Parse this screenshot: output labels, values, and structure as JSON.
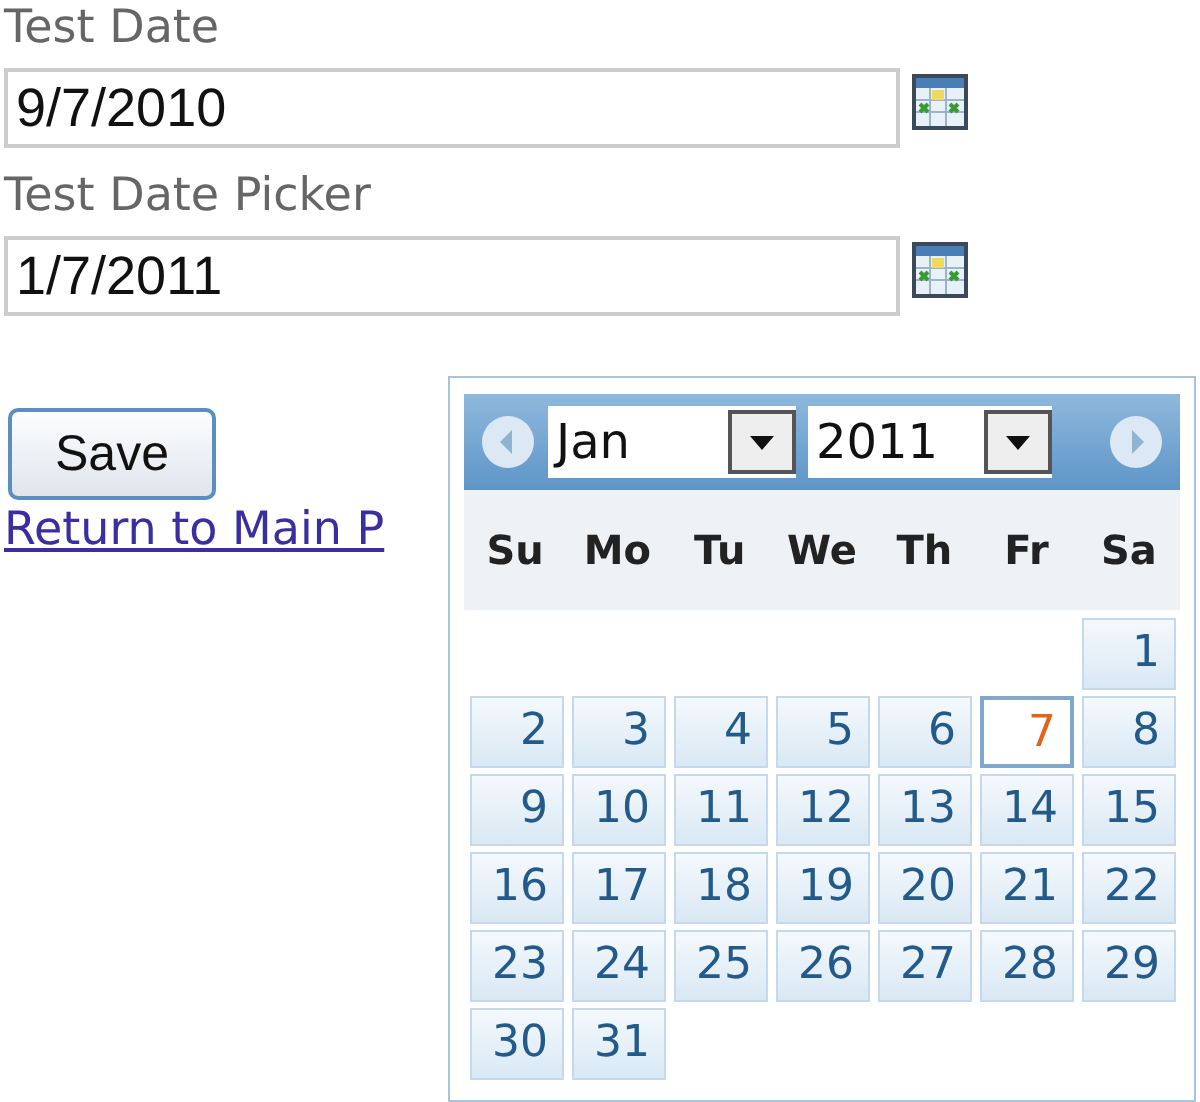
{
  "fields": [
    {
      "label": "Test Date",
      "value": "9/7/2010"
    },
    {
      "label": "Test Date Picker",
      "value": "1/7/2011"
    }
  ],
  "save_button": "Save",
  "link": "Return to Main P",
  "calendar": {
    "month": "Jan",
    "year": "2011",
    "weekdays": [
      "Su",
      "Mo",
      "Tu",
      "We",
      "Th",
      "Fr",
      "Sa"
    ],
    "weeks": [
      {
        "kind": "first",
        "days": [
          {
            "day": "1",
            "selected": false
          }
        ]
      },
      {
        "kind": "full",
        "days": [
          {
            "day": "2",
            "selected": false
          },
          {
            "day": "3",
            "selected": false
          },
          {
            "day": "4",
            "selected": false
          },
          {
            "day": "5",
            "selected": false
          },
          {
            "day": "6",
            "selected": false
          },
          {
            "day": "7",
            "selected": true
          },
          {
            "day": "8",
            "selected": false
          }
        ]
      },
      {
        "kind": "full",
        "days": [
          {
            "day": "9",
            "selected": false
          },
          {
            "day": "10",
            "selected": false
          },
          {
            "day": "11",
            "selected": false
          },
          {
            "day": "12",
            "selected": false
          },
          {
            "day": "13",
            "selected": false
          },
          {
            "day": "14",
            "selected": false
          },
          {
            "day": "15",
            "selected": false
          }
        ]
      },
      {
        "kind": "full",
        "days": [
          {
            "day": "16",
            "selected": false
          },
          {
            "day": "17",
            "selected": false
          },
          {
            "day": "18",
            "selected": false
          },
          {
            "day": "19",
            "selected": false
          },
          {
            "day": "20",
            "selected": false
          },
          {
            "day": "21",
            "selected": false
          },
          {
            "day": "22",
            "selected": false
          }
        ]
      },
      {
        "kind": "full",
        "days": [
          {
            "day": "23",
            "selected": false
          },
          {
            "day": "24",
            "selected": false
          },
          {
            "day": "25",
            "selected": false
          },
          {
            "day": "26",
            "selected": false
          },
          {
            "day": "27",
            "selected": false
          },
          {
            "day": "28",
            "selected": false
          },
          {
            "day": "29",
            "selected": false
          }
        ]
      },
      {
        "kind": "last",
        "days": [
          {
            "day": "30",
            "selected": false
          },
          {
            "day": "31",
            "selected": false
          }
        ]
      }
    ]
  }
}
